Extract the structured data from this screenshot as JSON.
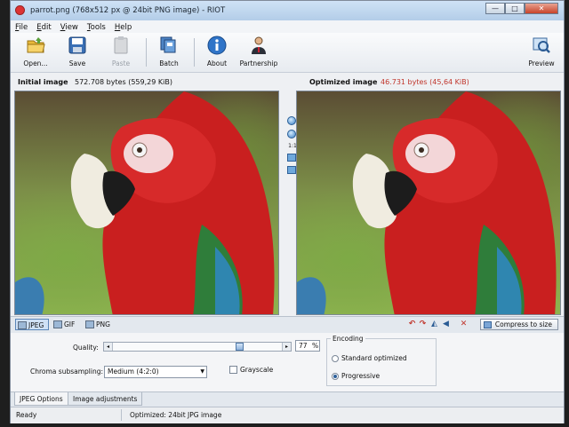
{
  "window": {
    "title": "parrot.png (768x512 px @ 24bit PNG image) - RIOT",
    "buttons": {
      "minimize": "—",
      "maximize": "□",
      "close": "✕"
    }
  },
  "menu": [
    "File",
    "Edit",
    "View",
    "Tools",
    "Help"
  ],
  "toolbar": {
    "open": "Open...",
    "save": "Save",
    "paste": "Paste",
    "batch": "Batch",
    "about": "About",
    "partnership": "Partnership",
    "preview": "Preview"
  },
  "info": {
    "initial_label": "Initial image",
    "initial_value": "572.708 bytes (559,29 KiB)",
    "optimized_label": "Optimized image",
    "optimized_value": "46.731 bytes (45,64 KiB)",
    "optimized_color": "#c0352b"
  },
  "side_tools": {
    "one_to_one": "1:1"
  },
  "formats": {
    "jpeg": "JPEG",
    "gif": "GIF",
    "png": "PNG"
  },
  "compress_label": "Compress to size",
  "options": {
    "quality_label": "Quality:",
    "quality_value": "77",
    "percent": "%",
    "chroma_label": "Chroma subsampling:",
    "chroma_value": "Medium (4:2:0)",
    "grayscale_label": "Grayscale",
    "encoding_title": "Encoding",
    "encoding_standard": "Standard optimized",
    "encoding_progressive": "Progressive"
  },
  "bottom_tabs": [
    "JPEG Options",
    "Image adjustments"
  ],
  "status": {
    "left": "Ready",
    "right": "Optimized: 24bit JPG image"
  }
}
